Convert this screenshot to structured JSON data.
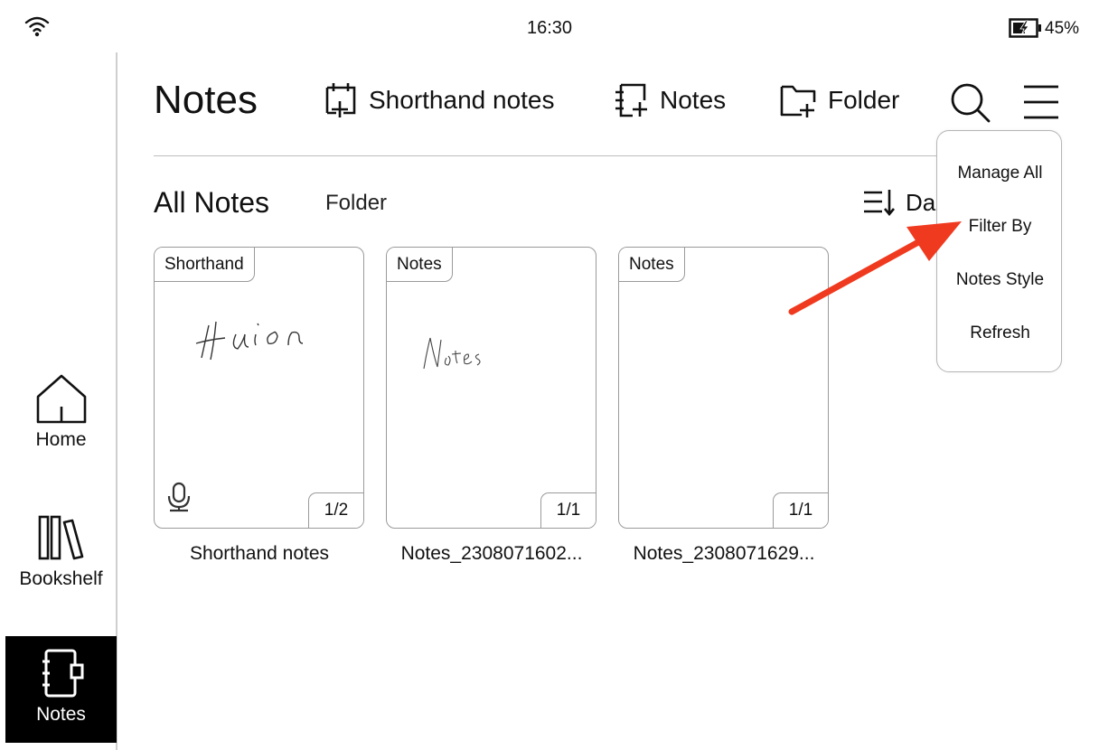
{
  "status": {
    "time": "16:30",
    "battery": "45%"
  },
  "sidebar": {
    "items": [
      {
        "label": "Home",
        "icon": "home-icon"
      },
      {
        "label": "Bookshelf",
        "icon": "bookshelf-icon"
      },
      {
        "label": "Notes",
        "icon": "notes-icon",
        "active": true
      }
    ]
  },
  "header": {
    "title": "Notes",
    "buttons": [
      {
        "label": "Shorthand notes",
        "icon": "new-shorthand-icon"
      },
      {
        "label": "Notes",
        "icon": "new-notes-icon"
      },
      {
        "label": "Folder",
        "icon": "new-folder-icon"
      }
    ]
  },
  "tabs": {
    "all": "All Notes",
    "folder": "Folder"
  },
  "sort": {
    "label": "Da"
  },
  "cards": [
    {
      "tag": "Shorthand",
      "pages": "1/2",
      "title": "Shorthand notes",
      "has_audio": true
    },
    {
      "tag": "Notes",
      "pages": "1/1",
      "title": "Notes_2308071602..."
    },
    {
      "tag": "Notes",
      "pages": "1/1",
      "title": "Notes_2308071629..."
    }
  ],
  "menu": {
    "items": [
      "Manage All",
      "Filter By",
      "Notes Style",
      "Refresh"
    ]
  },
  "colors": {
    "accent_arrow": "#f03a1f",
    "active_nav_bg": "#000000"
  }
}
